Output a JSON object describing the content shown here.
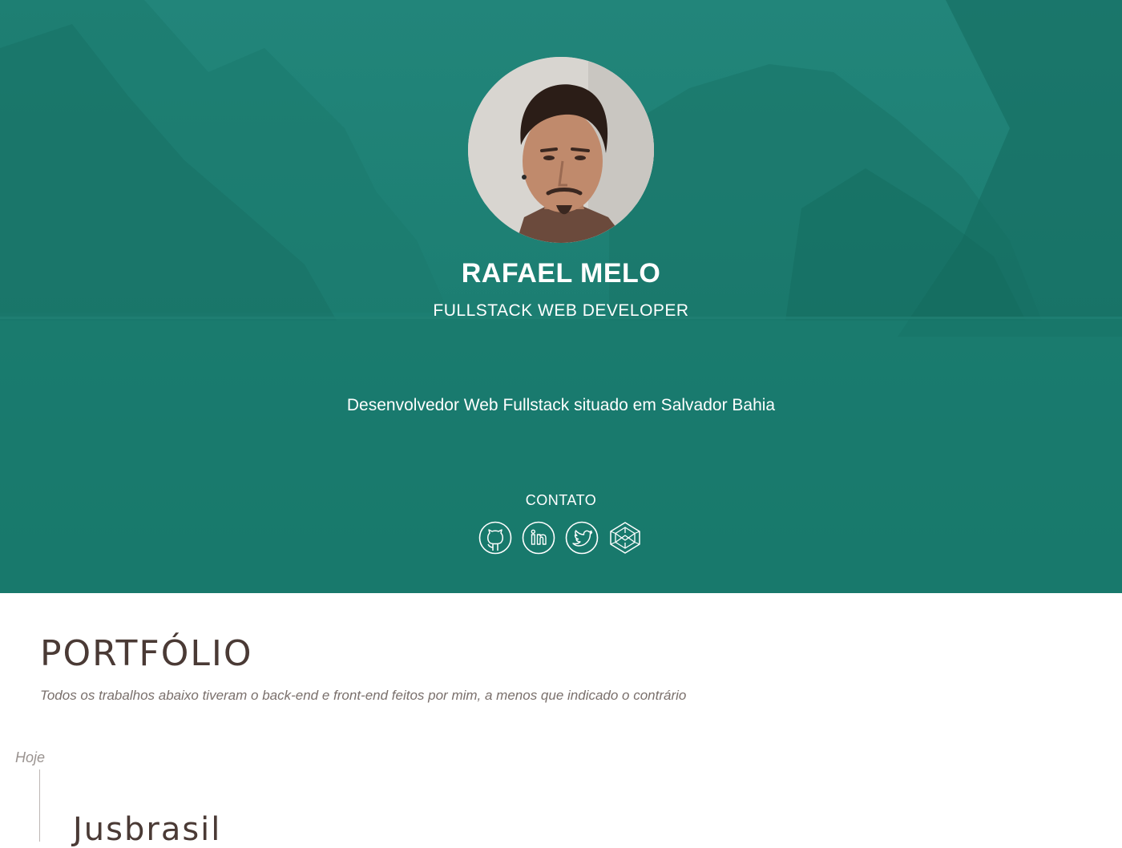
{
  "hero": {
    "name": "RAFAEL MELO",
    "role": "FULLSTACK WEB DEVELOPER",
    "description": "Desenvolvedor Web Fullstack situado em Salvador Bahia",
    "contact_label": "CONTATO",
    "social": [
      {
        "icon": "github-icon"
      },
      {
        "icon": "linkedin-icon"
      },
      {
        "icon": "twitter-icon"
      },
      {
        "icon": "codepen-icon"
      }
    ],
    "colors": {
      "overlay": "#1d7c6f",
      "text": "#ffffff"
    }
  },
  "portfolio": {
    "title": "PORTFÓLIO",
    "subtitle": "Todos os trabalhos abaixo tiveram o back-end e front-end feitos por mim, a menos que indicado o contrário",
    "timeline_label": "Hoje",
    "projects": [
      {
        "title": "Jusbrasil"
      }
    ],
    "colors": {
      "heading": "#4a3a35",
      "subtitle": "#7a706c"
    }
  }
}
